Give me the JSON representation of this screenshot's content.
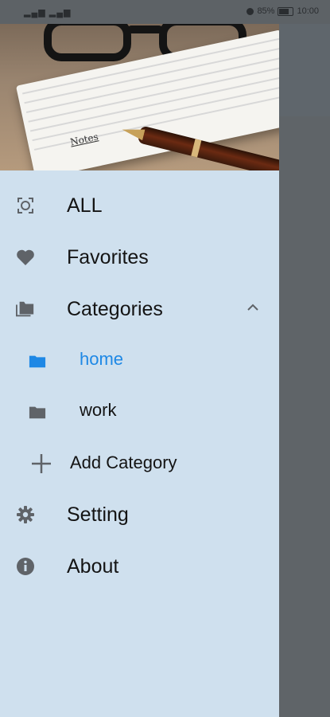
{
  "status_bar": {
    "signal": "▂▄▆ ▂▄▆",
    "battery": "85%",
    "time": "10:00"
  },
  "header": {
    "notebook_text": "Notes"
  },
  "menu": {
    "all": "ALL",
    "favorites": "Favorites",
    "categories": "Categories",
    "category_items": [
      {
        "label": "home",
        "color": "#1e88e5",
        "selected": true
      },
      {
        "label": "work",
        "color": "#141414",
        "selected": false
      }
    ],
    "add_category": "Add Category",
    "setting": "Setting",
    "about": "About"
  },
  "colors": {
    "drawer_bg": "#cfe0ee",
    "accent": "#1e88e5",
    "icon_gray": "#5f6368"
  }
}
